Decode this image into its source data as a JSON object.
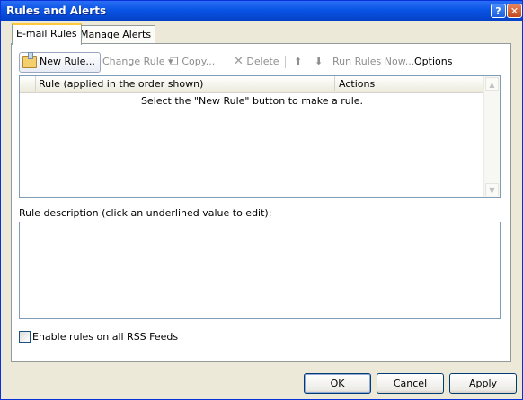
{
  "window": {
    "title": "Rules and Alerts",
    "help_glyph": "?",
    "close_glyph": "✕"
  },
  "tabs": [
    {
      "label": "E-mail Rules",
      "active": true
    },
    {
      "label": "Manage Alerts",
      "active": false
    }
  ],
  "toolbar": {
    "new_rule": "New Rule...",
    "change_rule": "Change Rule ▾",
    "copy": "Copy...",
    "delete": "Delete",
    "move_up_glyph": "⬆",
    "move_down_glyph": "⬇",
    "run_rules_now": "Run Rules Now...",
    "options": "Options",
    "copy_icon_glyph": "❐",
    "delete_icon_glyph": "✕"
  },
  "rules_list": {
    "columns": [
      "Rule (applied in the order shown)",
      "Actions"
    ],
    "empty_message": "Select the \"New Rule\" button to make a rule.",
    "scroll_up_glyph": "▲",
    "scroll_down_glyph": "▼"
  },
  "description": {
    "label": "Rule description (click an underlined value to edit):"
  },
  "rss": {
    "label": "Enable rules on all RSS Feeds",
    "checked": false
  },
  "buttons": {
    "ok": "OK",
    "cancel": "Cancel",
    "apply": "Apply"
  },
  "colors": {
    "titlebar": "#0a55e5",
    "tab_highlight": "#ffc73c",
    "dialog_bg": "#ece9d8",
    "border": "#7f9db9"
  }
}
